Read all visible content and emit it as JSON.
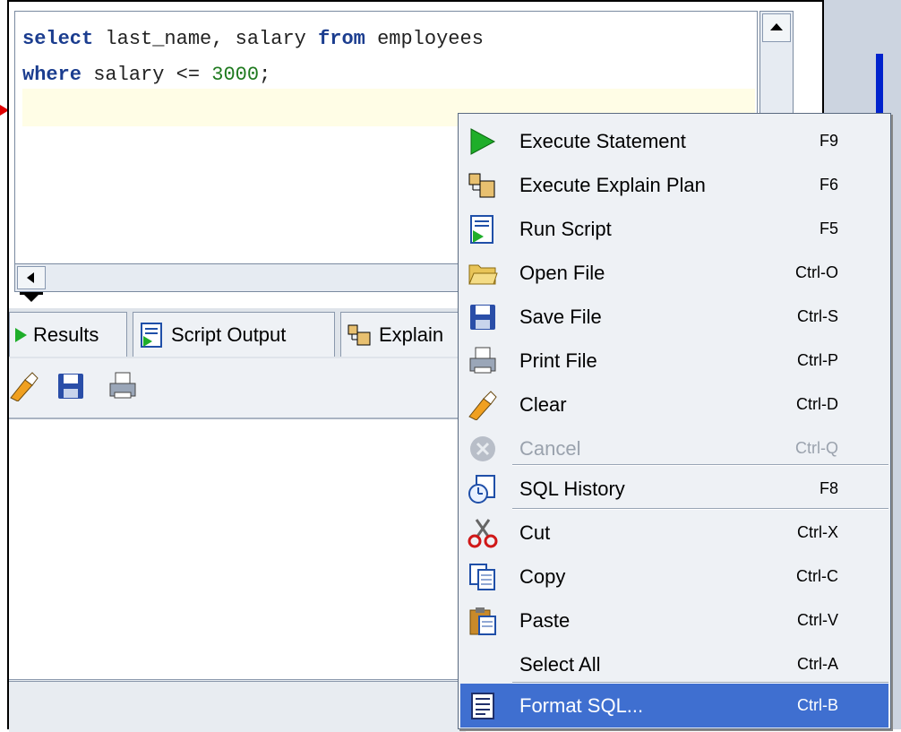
{
  "editor": {
    "line1": {
      "kw1": "select",
      "t1": " last_name, salary ",
      "kw2": "from",
      "t2": " employees"
    },
    "line2": {
      "kw1": "where",
      "t1": " salary <= ",
      "num": "3000",
      "t2": ";"
    }
  },
  "tabs": [
    {
      "label": "Results"
    },
    {
      "label": "Script Output"
    },
    {
      "label": "Explain"
    }
  ],
  "toolbar": {
    "icons": [
      "eraser-icon",
      "save-icon",
      "print-icon"
    ]
  },
  "context_menu": {
    "items": [
      {
        "label": "Execute Statement",
        "shortcut": "F9",
        "icon": "run-icon"
      },
      {
        "label": "Execute Explain Plan",
        "shortcut": "F6",
        "icon": "explain-icon"
      },
      {
        "label": "Run Script",
        "shortcut": "F5",
        "icon": "script-icon"
      },
      {
        "label": "Open File",
        "shortcut": "Ctrl-O",
        "icon": "folder-icon"
      },
      {
        "label": "Save File",
        "shortcut": "Ctrl-S",
        "icon": "save-icon"
      },
      {
        "label": "Print File",
        "shortcut": "Ctrl-P",
        "icon": "print-icon"
      },
      {
        "label": "Clear",
        "shortcut": "Ctrl-D",
        "icon": "eraser-icon"
      },
      {
        "label": "Cancel",
        "shortcut": "Ctrl-Q",
        "icon": "cancel-icon",
        "disabled": true
      },
      {
        "label": "SQL History",
        "shortcut": "F8",
        "icon": "history-icon"
      },
      {
        "label": "Cut",
        "shortcut": "Ctrl-X",
        "icon": "scissors-icon"
      },
      {
        "label": "Copy",
        "shortcut": "Ctrl-C",
        "icon": "copy-icon"
      },
      {
        "label": "Paste",
        "shortcut": "Ctrl-V",
        "icon": "paste-icon"
      },
      {
        "label": "Select All",
        "shortcut": "Ctrl-A",
        "icon": ""
      },
      {
        "label": "Format SQL...",
        "shortcut": "Ctrl-B",
        "icon": "format-icon",
        "selected": true
      }
    ]
  },
  "colors": {
    "keyword": "#1b3d8f",
    "number": "#1f7a1f",
    "selection": "#3f6fd0",
    "menu_bg": "#eef1f5"
  }
}
